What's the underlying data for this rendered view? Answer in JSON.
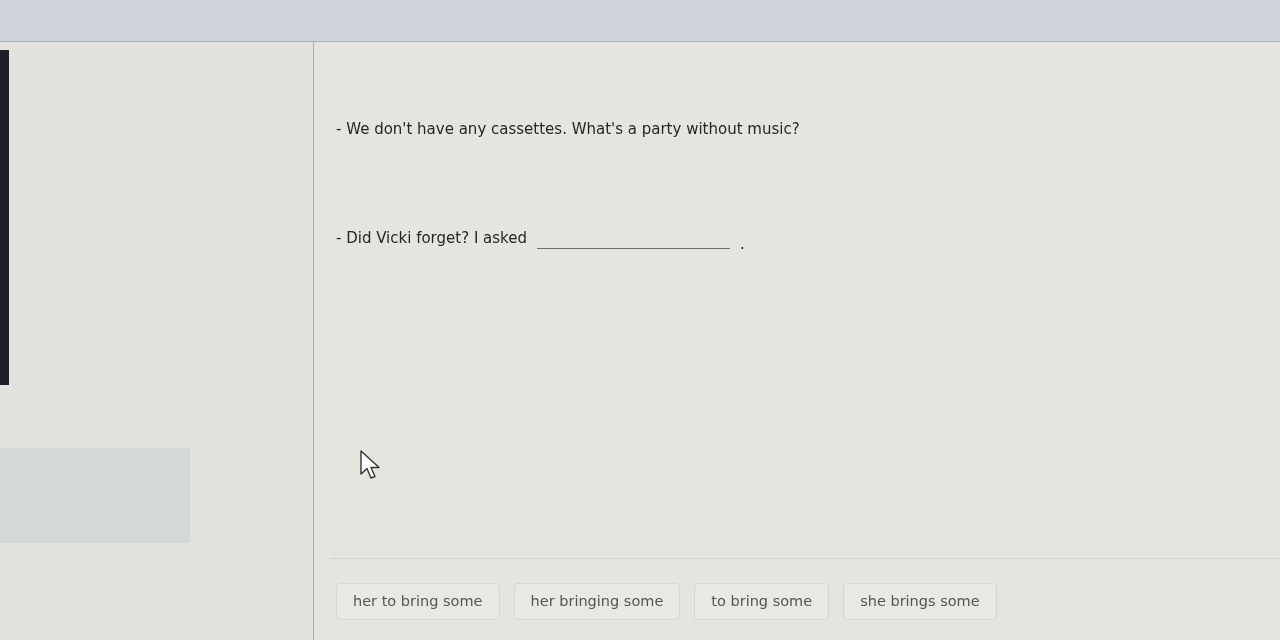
{
  "dialogue": [
    {
      "kind": "line",
      "text": "- We don't have any cassettes. What's a party without music?"
    },
    {
      "kind": "gap",
      "before": "- Did Vicki forget? I asked",
      "after": "."
    }
  ],
  "options": [
    {
      "label": "her to bring some"
    },
    {
      "label": "her bringing some"
    },
    {
      "label": "to bring some"
    },
    {
      "label": "she brings some"
    }
  ]
}
